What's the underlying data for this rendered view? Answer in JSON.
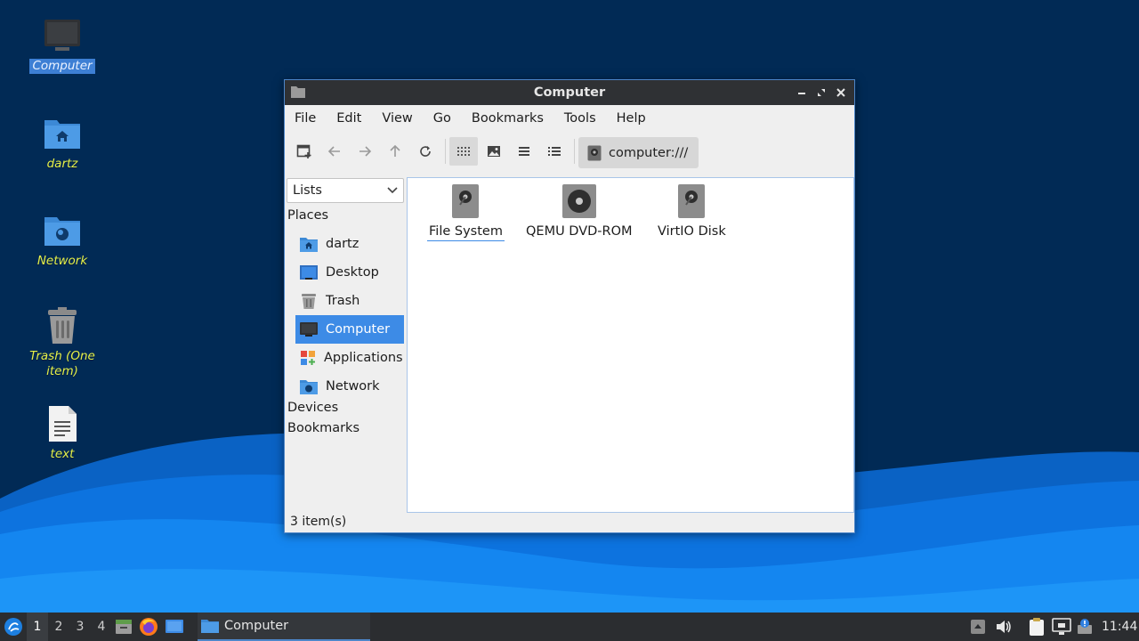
{
  "desktop": {
    "icons": [
      {
        "label": "Computer"
      },
      {
        "label": "dartz"
      },
      {
        "label": "Network"
      },
      {
        "label": "Trash (One item)"
      },
      {
        "label": "text"
      }
    ]
  },
  "window": {
    "title": "Computer",
    "menu": [
      "File",
      "Edit",
      "View",
      "Go",
      "Bookmarks",
      "Tools",
      "Help"
    ],
    "location": "computer:///",
    "side": {
      "select_value": "Lists",
      "places_heading": "Places",
      "places": [
        "dartz",
        "Desktop",
        "Trash",
        "Computer",
        "Applications",
        "Network"
      ],
      "devices_heading": "Devices",
      "bookmarks_heading": "Bookmarks"
    },
    "files": [
      "File System",
      "QEMU DVD-ROM",
      "VirtIO Disk"
    ],
    "status": "3 item(s)"
  },
  "taskbar": {
    "workspaces": [
      "1",
      "2",
      "3",
      "4"
    ],
    "task_label": "Computer",
    "clock": "11:44"
  },
  "colors": {
    "accent": "#3d8be6",
    "desktop_label": "#e6f04a",
    "titlebar": "#2f3134",
    "taskbar": "#2b2d30"
  }
}
